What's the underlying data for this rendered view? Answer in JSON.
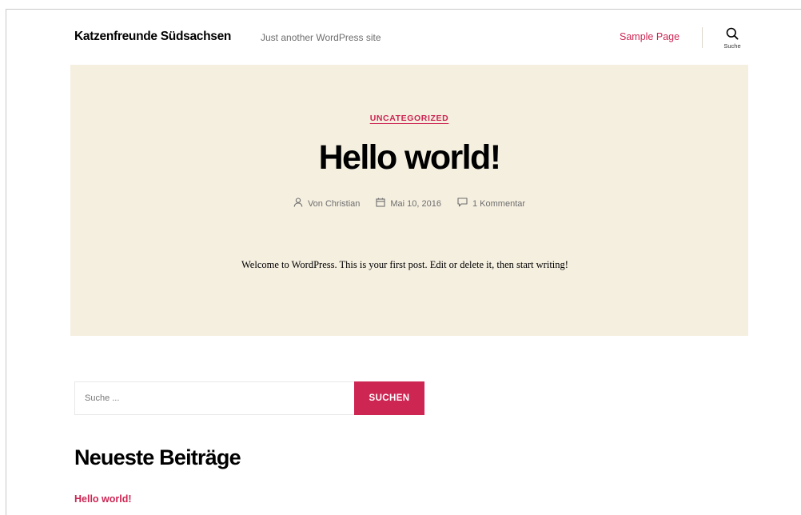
{
  "header": {
    "site_title": "Katzenfreunde Südsachsen",
    "tagline": "Just another WordPress site",
    "nav": [
      {
        "label": "Sample Page"
      }
    ],
    "search_toggle_label": "Suche"
  },
  "post": {
    "category": "UNCATEGORIZED",
    "title": "Hello world!",
    "meta": {
      "author": "Von Christian",
      "date": "Mai 10, 2016",
      "comments": "1 Kommentar"
    },
    "excerpt": "Welcome to WordPress. This is your first post. Edit or delete it, then start writing!"
  },
  "search_form": {
    "placeholder": "Suche ...",
    "button_label": "SUCHEN"
  },
  "recent_posts": {
    "title": "Neueste Beiträge",
    "items": [
      {
        "label": "Hello world!"
      }
    ]
  },
  "colors": {
    "accent": "#cd2653",
    "hero_background": "#f5efe0",
    "meta_text": "#6d6d6d"
  },
  "icons": [
    "search-icon",
    "user-icon",
    "calendar-icon",
    "comment-icon"
  ]
}
